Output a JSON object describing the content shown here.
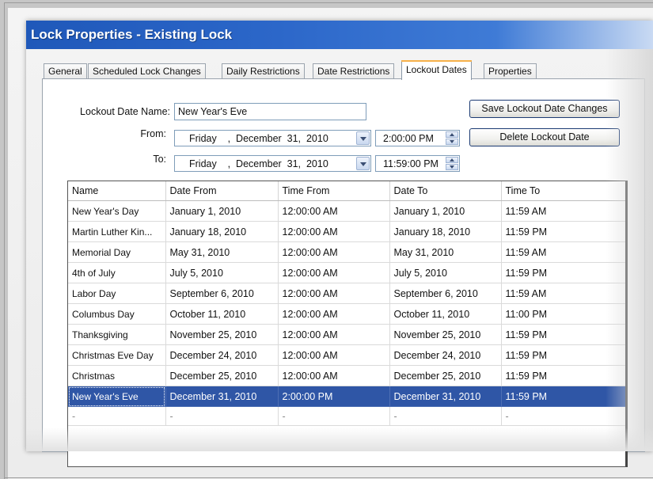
{
  "window": {
    "title": "Lock Properties - Existing Lock"
  },
  "tabs": [
    {
      "label": "General",
      "active": false
    },
    {
      "label": "Scheduled Lock Changes",
      "active": false
    },
    {
      "label": "Daily Restrictions",
      "active": false
    },
    {
      "label": "Date Restrictions",
      "active": false
    },
    {
      "label": "Lockout Dates",
      "active": true
    },
    {
      "label": "Properties",
      "active": false
    }
  ],
  "form": {
    "name_label": "Lockout Date Name:",
    "name_value": "New Year's Eve",
    "from_label": "From:",
    "from_date": "Friday    ,  December  31,  2010",
    "from_time": "2:00:00 PM",
    "to_label": "To:",
    "to_date": "Friday    ,  December  31,  2010",
    "to_time": "11:59:00 PM",
    "save_button": "Save Lockout Date Changes",
    "delete_button": "Delete Lockout Date"
  },
  "table": {
    "columns": [
      "Name",
      "Date From",
      "Time From",
      "Date To",
      "Time To"
    ],
    "rows": [
      [
        "New Year's Day",
        "January 1, 2010",
        "12:00:00 AM",
        "January 1, 2010",
        "11:59 AM"
      ],
      [
        "Martin Luther Kin...",
        "January 18, 2010",
        "12:00:00 AM",
        "January 18, 2010",
        "11:59 PM"
      ],
      [
        "Memorial Day",
        "May 31, 2010",
        "12:00:00 AM",
        "May 31, 2010",
        "11:59 AM"
      ],
      [
        "4th of July",
        "July 5, 2010",
        "12:00:00 AM",
        "July 5, 2010",
        "11:59 PM"
      ],
      [
        "Labor Day",
        "September 6, 2010",
        "12:00:00 AM",
        "September 6, 2010",
        "11:59 AM"
      ],
      [
        "Columbus Day",
        "October 11, 2010",
        "12:00:00 AM",
        "October 11, 2010",
        "11:00 PM"
      ],
      [
        "Thanksgiving",
        "November 25, 2010",
        "12:00:00 AM",
        "November 25, 2010",
        "11:59 PM"
      ],
      [
        "Christmas Eve Day",
        "December 24, 2010",
        "12:00:00 AM",
        "December 24, 2010",
        "11:59 PM"
      ],
      [
        "Christmas",
        "December 25, 2010",
        "12:00:00 AM",
        "December 25, 2010",
        "11:59 PM"
      ],
      [
        "New Year's Eve",
        "December 31, 2010",
        "2:00:00 PM",
        "December 31, 2010",
        "11:59 PM"
      ]
    ],
    "selected_row": 9,
    "empty_row": [
      "-",
      "-",
      "-",
      "-",
      "-"
    ]
  },
  "colors": {
    "title_bar": "#1f58b9",
    "selection": "#2f56a6",
    "active_tab_accent": "#f7b14a"
  },
  "icons": {
    "date_dropdown": "chevron-down-icon",
    "time_spinner": "spinner-icon"
  }
}
